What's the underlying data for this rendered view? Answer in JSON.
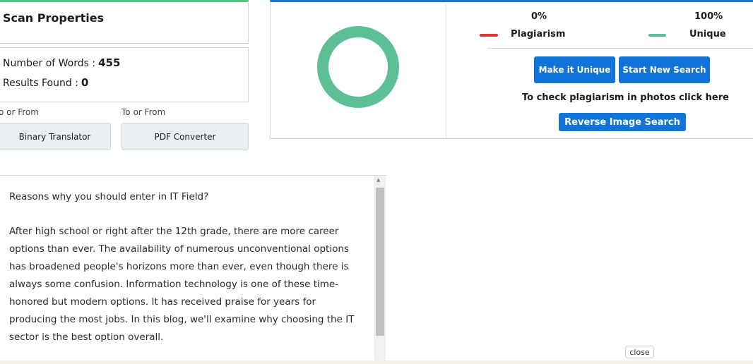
{
  "scan": {
    "title": "Scan Properties",
    "words_label": "Number of Words :",
    "words_value": "455",
    "results_label": "Results Found :",
    "results_value": "0"
  },
  "tools": [
    {
      "label": "o or From",
      "button": "Binary Translator"
    },
    {
      "label": "To or From",
      "button": "PDF Converter"
    }
  ],
  "results": {
    "plagiarism_pct": "0%",
    "unique_pct": "100%",
    "plagiarism_label": "Plagiarism",
    "unique_label": "Unique",
    "donut_unique_fraction": 1.0,
    "make_unique_button": "Make it Unique",
    "new_search_button": "Start New Search",
    "photo_text": "To check plagiarism in photos click here",
    "reverse_image_button": "Reverse Image Search"
  },
  "colors": {
    "plagiarism": "#d33a3a",
    "unique": "#5cbf96",
    "accent_blue": "#1274d8"
  },
  "document": {
    "paragraphs": [
      "Reasons why you should enter in IT Field?",
      "After high school or right after the 12th grade, there are more career options than ever. The availability of numerous unconventional options has broadened people's horizons more than ever, even though there is always some confusion. Information technology is one of these time-honored but modern options. It has received praise for years for producing the most jobs. In this blog, we'll examine why choosing the IT sector is the best option overall."
    ]
  },
  "close_label": "close"
}
